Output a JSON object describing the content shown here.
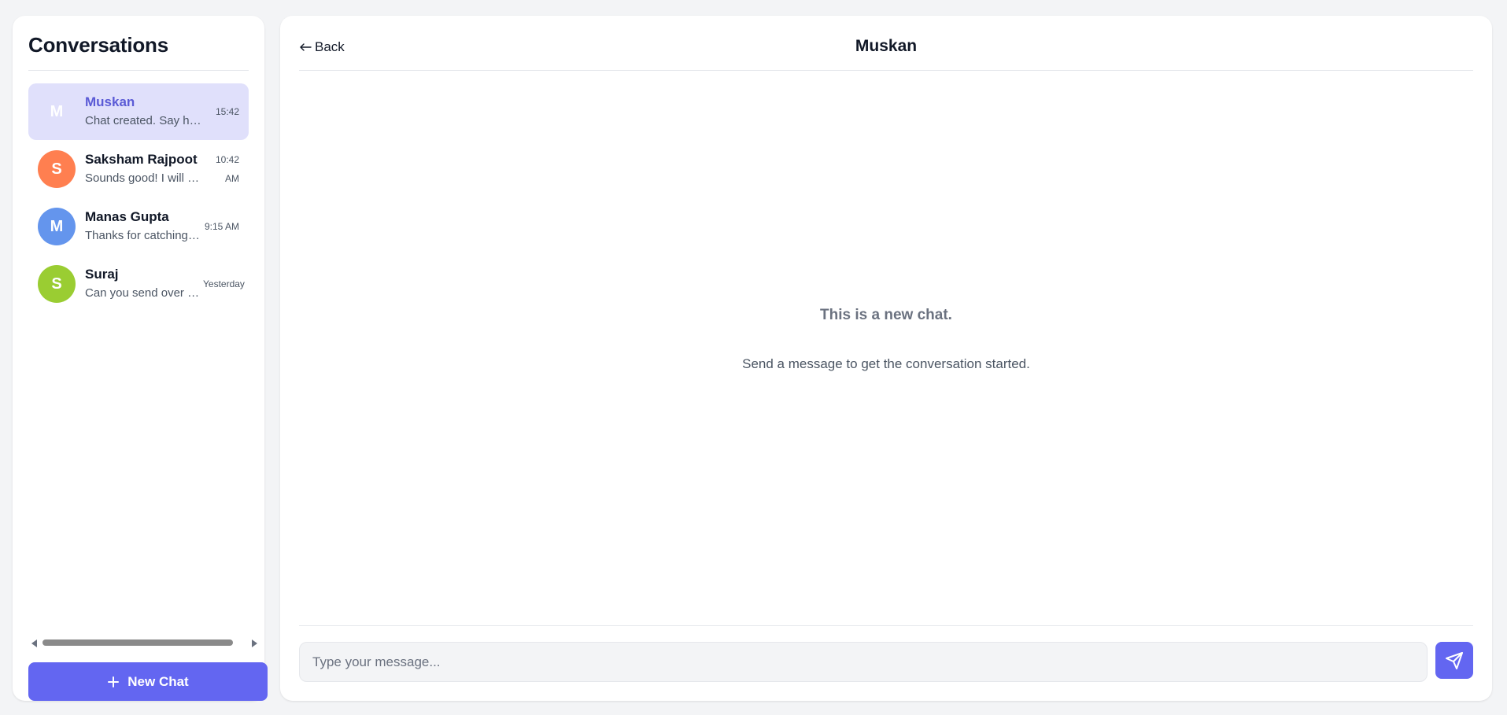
{
  "sidebar": {
    "title": "Conversations",
    "new_chat_label": "New Chat",
    "conversations": [
      {
        "initial": "M",
        "name": "Muskan",
        "preview": "Chat created. Say hello!",
        "time": "15:42",
        "avatar_color": "#e0e0fb",
        "active": true
      },
      {
        "initial": "S",
        "name": "Saksham Rajpoot",
        "preview": "Sounds good! I will check it",
        "time": "10:42 AM",
        "avatar_color": "#ff7f50",
        "active": false
      },
      {
        "initial": "M",
        "name": "Manas Gupta",
        "preview": "Thanks for catching up",
        "time": "9:15 AM",
        "avatar_color": "#6495ed",
        "active": false
      },
      {
        "initial": "S",
        "name": "Suraj",
        "preview": "Can you send over the file",
        "time": "Yesterday",
        "avatar_color": "#9acd32",
        "active": false
      }
    ]
  },
  "chat": {
    "back_label": "Back",
    "title": "Muskan",
    "empty_title": "This is a new chat.",
    "empty_subtitle": "Send a message to get the conversation started.",
    "input_placeholder": "Type your message..."
  },
  "colors": {
    "accent": "#6366f1",
    "active_item_bg": "#e0e0fb",
    "active_name": "#5b5bd6",
    "page_bg": "#f3f4f6"
  }
}
